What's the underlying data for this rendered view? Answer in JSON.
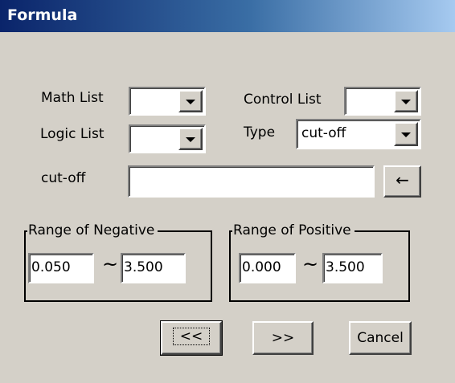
{
  "window": {
    "title": "Formula"
  },
  "math_list": {
    "label": "Math List",
    "value": ""
  },
  "control_list": {
    "label": "Control List",
    "value": ""
  },
  "logic_list": {
    "label": "Logic List",
    "value": ""
  },
  "type": {
    "label": "Type",
    "value": "cut-off"
  },
  "cutoff": {
    "label": "cut-off",
    "value": "",
    "insert_button": "←"
  },
  "range_negative": {
    "title": "Range of Negative",
    "min": "0.050",
    "separator": "~",
    "max": "3.500"
  },
  "range_positive": {
    "title": "Range of Positive",
    "min": "0.000",
    "separator": "~",
    "max": "3.500"
  },
  "buttons": {
    "prev": "<<",
    "next": ">>",
    "cancel": "Cancel"
  },
  "colors": {
    "face": "#d4d0c8",
    "title_start": "#0a246a",
    "title_end": "#a6caf0"
  }
}
